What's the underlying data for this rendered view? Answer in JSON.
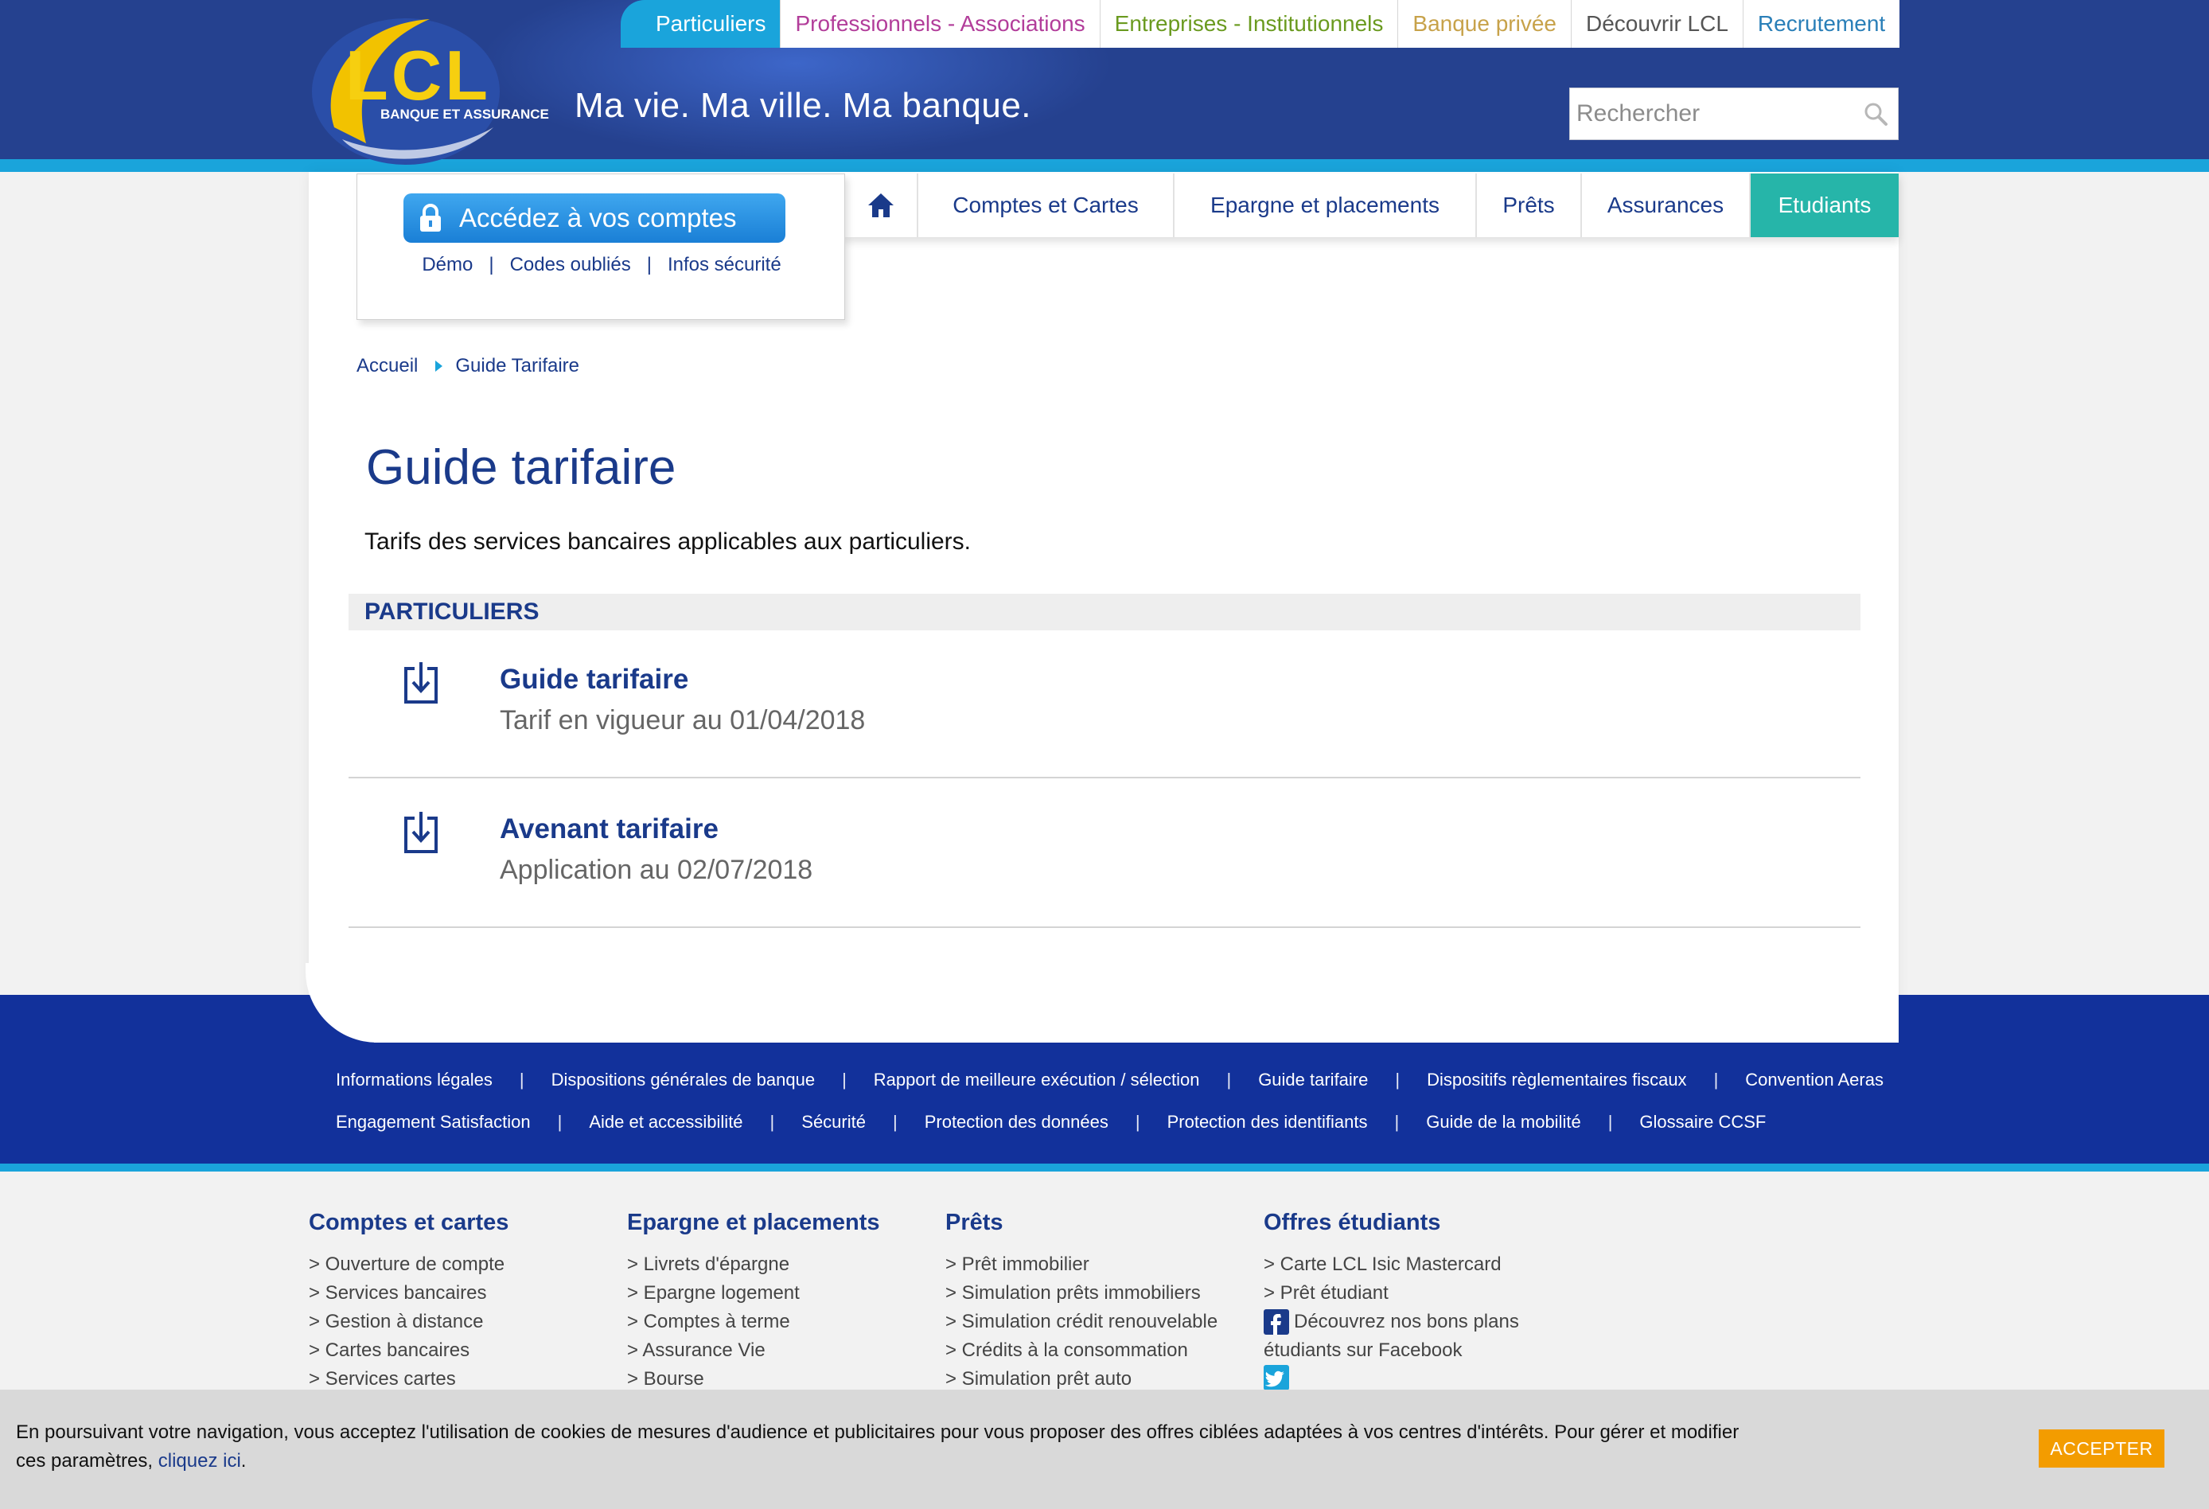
{
  "colors": {
    "brand_blue": "#25418f",
    "cyan": "#1aa4db",
    "dark_footer": "#12319b",
    "teal_active": "#26b5a9",
    "accept_orange": "#f39c00"
  },
  "header": {
    "logo_text": "LCL",
    "logo_subtext": "BANQUE ET ASSURANCE",
    "slogan": "Ma vie. Ma ville. Ma banque.",
    "search_placeholder": "Rechercher",
    "search_icon": "search-icon"
  },
  "top_nav": [
    {
      "label": "Particuliers",
      "color": "#ffffff",
      "active": true
    },
    {
      "label": "Professionnels - Associations",
      "color": "#b23d9a"
    },
    {
      "label": "Entreprises - Institutionnels",
      "color": "#6a9a1f"
    },
    {
      "label": "Banque privée",
      "color": "#c7a24a"
    },
    {
      "label": "Découvrir LCL",
      "color": "#555555"
    },
    {
      "label": "Recrutement",
      "color": "#2a7fb8"
    }
  ],
  "login": {
    "button_label": "Accédez à vos comptes",
    "icon": "lock-icon",
    "links": [
      "Démo",
      "Codes oubliés",
      "Infos sécurité"
    ],
    "separator": "|"
  },
  "main_nav": {
    "home_icon": "home-icon",
    "items": [
      {
        "label": "Comptes et Cartes"
      },
      {
        "label": "Epargne et placements"
      },
      {
        "label": "Prêts"
      },
      {
        "label": "Assurances"
      },
      {
        "label": "Etudiants",
        "active": true
      }
    ]
  },
  "breadcrumb": [
    "Accueil",
    "Guide Tarifaire"
  ],
  "main": {
    "title": "Guide tarifaire",
    "intro": "Tarifs des services bancaires applicables aux particuliers.",
    "section_label": "PARTICULIERS",
    "documents": [
      {
        "title": "Guide tarifaire",
        "subtitle": "Tarif en vigueur au 01/04/2018",
        "icon": "download-icon"
      },
      {
        "title": "Avenant tarifaire",
        "subtitle": "Application au 02/07/2018",
        "icon": "download-icon"
      }
    ]
  },
  "footer_links": {
    "row1": [
      "Informations légales",
      "Dispositions générales de banque",
      "Rapport de meilleure exécution / sélection",
      "Guide tarifaire",
      "Dispositifs règlementaires fiscaux",
      "Convention Aeras"
    ],
    "row2": [
      "Engagement Satisfaction",
      "Aide et accessibilité",
      "Sécurité",
      "Protection des données",
      "Protection des identifiants",
      "Guide de la mobilité",
      "Glossaire CCSF"
    ]
  },
  "footer_columns": [
    {
      "title": "Comptes et cartes",
      "items": [
        "> Ouverture de compte",
        "> Services bancaires",
        "> Gestion à distance",
        "> Cartes bancaires",
        "> Services cartes"
      ]
    },
    {
      "title": "Epargne et placements",
      "items": [
        "> Livrets d'épargne",
        "> Epargne logement",
        "> Comptes à terme",
        "> Assurance Vie",
        "> Bourse"
      ]
    },
    {
      "title": "Prêts",
      "items": [
        "> Prêt immobilier",
        "> Simulation prêts immobiliers",
        "> Simulation crédit renouvelable",
        "> Crédits à la consommation",
        "> Simulation prêt auto"
      ]
    },
    {
      "title": "Offres étudiants",
      "items": [
        "> Carte LCL Isic Mastercard",
        "> Prêt étudiant"
      ],
      "facebook_text_1": "Découvrez nos bons plans",
      "facebook_text_2": "étudiants sur Facebook",
      "facebook_icon": "facebook-icon",
      "twitter_icon": "twitter-icon"
    }
  ],
  "cookie": {
    "text_line1": "En poursuivant votre navigation, vous acceptez l'utilisation de cookies de mesures d'audience et publicitaires pour vous proposer des offres ciblées adaptées à vos centres d'intérêts. Pour gérer et modifier",
    "text_line2_prefix": "ces paramètres,",
    "link_label": "cliquez ici",
    "text_line2_suffix": ".",
    "accept_label": "ACCEPTER"
  }
}
